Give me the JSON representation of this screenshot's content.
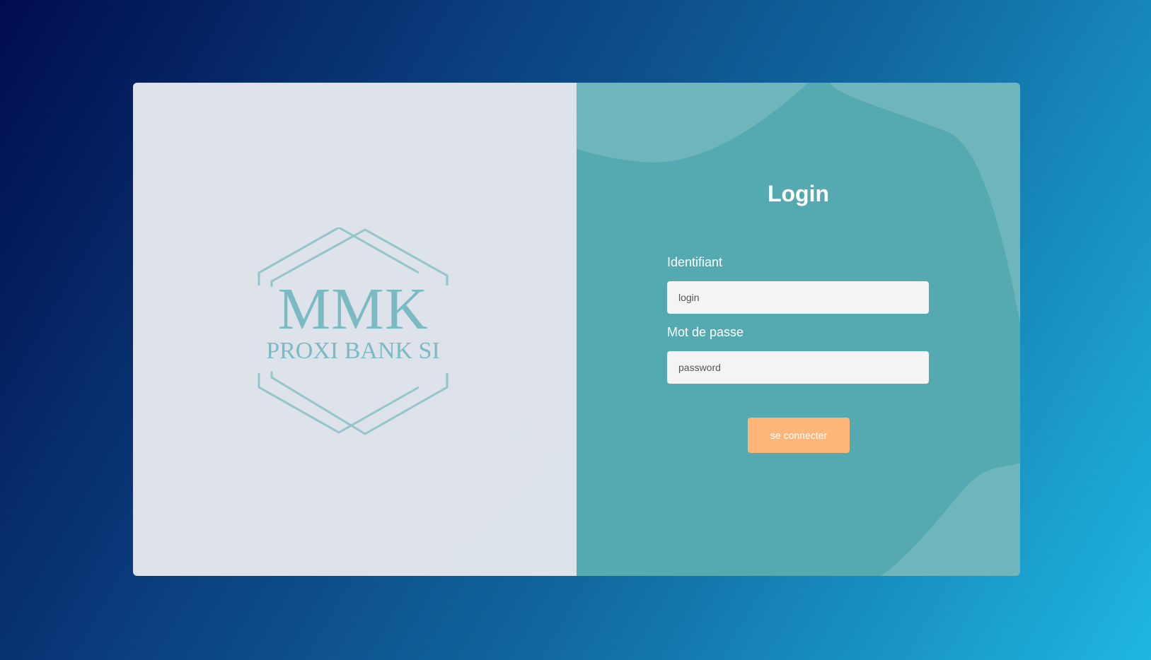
{
  "logo": {
    "title": "MMK",
    "subtitle": "PROXI BANK SI"
  },
  "login": {
    "title": "Login",
    "username_label": "Identifiant",
    "username_placeholder": "login",
    "username_value": "",
    "password_label": "Mot de passe",
    "password_placeholder": "password",
    "password_value": "",
    "submit_label": "se connecter"
  },
  "colors": {
    "accent_button": "#ffb678",
    "panel_teal": "#55a9b1",
    "logo_color": "#7cbac3"
  }
}
